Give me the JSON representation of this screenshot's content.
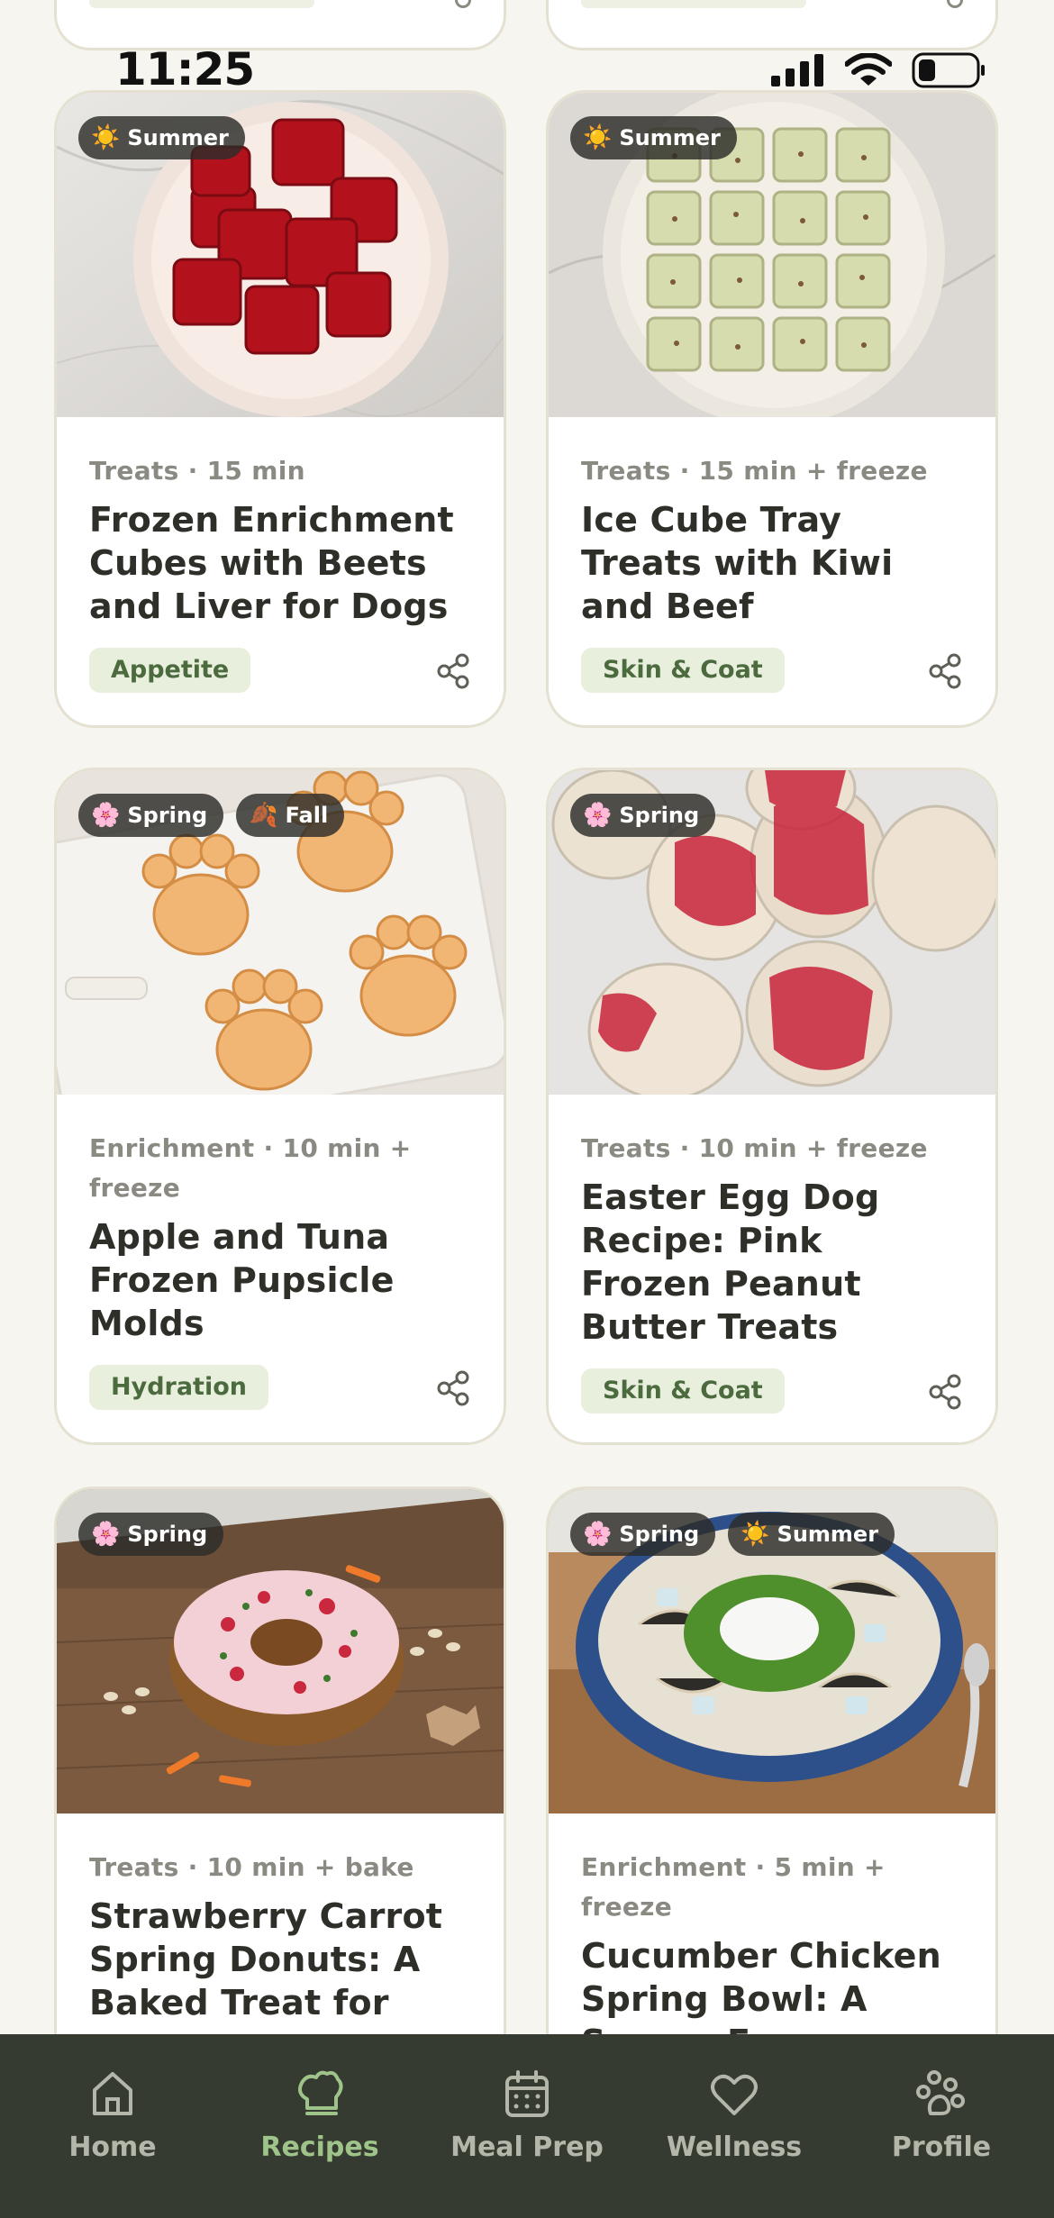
{
  "status_bar": {
    "time": "11:25"
  },
  "recipes": [
    {
      "id": "c1",
      "category": "Treats",
      "time": "15 min",
      "title": "Frozen Enrichment Cubes with Beets and Liver for Dogs",
      "tag": "Appetite",
      "seasons": [
        {
          "icon": "sun-icon",
          "glyph": "☀️",
          "label": "Summer"
        }
      ]
    },
    {
      "id": "c2",
      "category": "Treats",
      "time": "15 min + freeze",
      "title": "Ice Cube Tray Treats with Kiwi and Beef",
      "tag": "Skin & Coat",
      "seasons": [
        {
          "icon": "sun-icon",
          "glyph": "☀️",
          "label": "Summer"
        }
      ]
    },
    {
      "id": "c3",
      "category": "Enrichment",
      "time": "10 min + freeze",
      "title": "Apple and Tuna Frozen Pupsicle Molds",
      "tag": "Hydration",
      "seasons": [
        {
          "icon": "flower-icon",
          "glyph": "🌸",
          "label": "Spring"
        },
        {
          "icon": "leaf-icon",
          "glyph": "🍂",
          "label": "Fall"
        }
      ]
    },
    {
      "id": "c4",
      "category": "Treats",
      "time": "10 min + freeze",
      "title": "Easter Egg Dog Recipe: Pink Frozen Peanut Butter Treats",
      "tag": "Skin & Coat",
      "seasons": [
        {
          "icon": "flower-icon",
          "glyph": "🌸",
          "label": "Spring"
        }
      ]
    },
    {
      "id": "c5",
      "category": "Treats",
      "time": "10 min + bake",
      "title": "Strawberry Carrot Spring Donuts: A Baked Treat for",
      "tag": "",
      "seasons": [
        {
          "icon": "flower-icon",
          "glyph": "🌸",
          "label": "Spring"
        }
      ]
    },
    {
      "id": "c6",
      "category": "Enrichment",
      "time": "5 min + freeze",
      "title": "Cucumber Chicken Spring Bowl: A Savory Frozen",
      "tag": "",
      "seasons": [
        {
          "icon": "flower-icon",
          "glyph": "🌸",
          "label": "Spring"
        },
        {
          "icon": "sun-icon",
          "glyph": "☀️",
          "label": "Summer"
        }
      ]
    }
  ],
  "tabs": [
    {
      "label": "Home",
      "icon": "home-icon",
      "active": false
    },
    {
      "label": "Recipes",
      "icon": "chef-hat-icon",
      "active": true
    },
    {
      "label": "Meal Prep",
      "icon": "calendar-icon",
      "active": false
    },
    {
      "label": "Wellness",
      "icon": "heart-icon",
      "active": false
    },
    {
      "label": "Profile",
      "icon": "paw-icon",
      "active": false
    }
  ],
  "colors": {
    "accent": "#9ec48a",
    "tab_bar": "#353b30",
    "tag_bg": "#e8efdc",
    "tag_text": "#4b6b3e",
    "background": "#f7f5ef"
  }
}
